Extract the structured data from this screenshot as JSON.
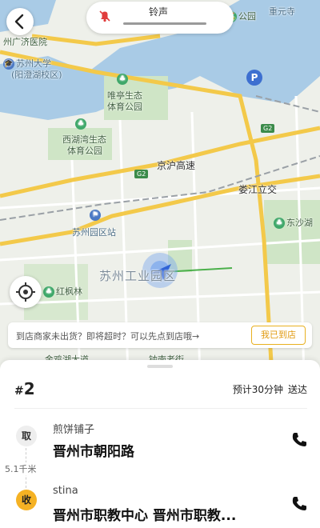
{
  "top": {
    "ring_label": "铃声"
  },
  "map": {
    "labels": {
      "park_top_right": "公园",
      "area_top_right": "重元寺",
      "hospital": "州广济医院",
      "university": "苏州大学",
      "university_campus": "(阳澄湖校区)",
      "weiting_park_line1": "唯亭生态",
      "weiting_park_line2": "体育公园",
      "xihu_park_line1": "西湖湾生态",
      "xihu_park_line2": "体育公园",
      "expressway": "京沪高速",
      "loujiang": "娄江立交",
      "dongshabang": "东沙湖",
      "station": "苏州园区站",
      "industrial_park": "苏州工业园区",
      "honghufeng": "红枫林",
      "road_bottom_left": "金鸡湖大道",
      "road_bottom_center": "钟南老街"
    },
    "g2_badge": "G2",
    "parking_badge": "P"
  },
  "notice": {
    "text": "到店商家未出货？即将超时？可以先点到店哦→",
    "button_label": "我已到店"
  },
  "order": {
    "hash": "#",
    "number": "2",
    "eta_text": "预计30分钟",
    "eta_type": "送达"
  },
  "pickup": {
    "tag": "取",
    "name": "煎饼铺子",
    "address": "晋州市朝阳路"
  },
  "distance": "5.1千米",
  "delivery": {
    "tag": "收",
    "name": "stina",
    "address": "晋州市职教中心 晋州市职教..."
  },
  "icons": {
    "back": "back-arrow-icon",
    "mute": "bell-muted-icon",
    "locate": "locate-icon",
    "phone": "phone-icon"
  }
}
